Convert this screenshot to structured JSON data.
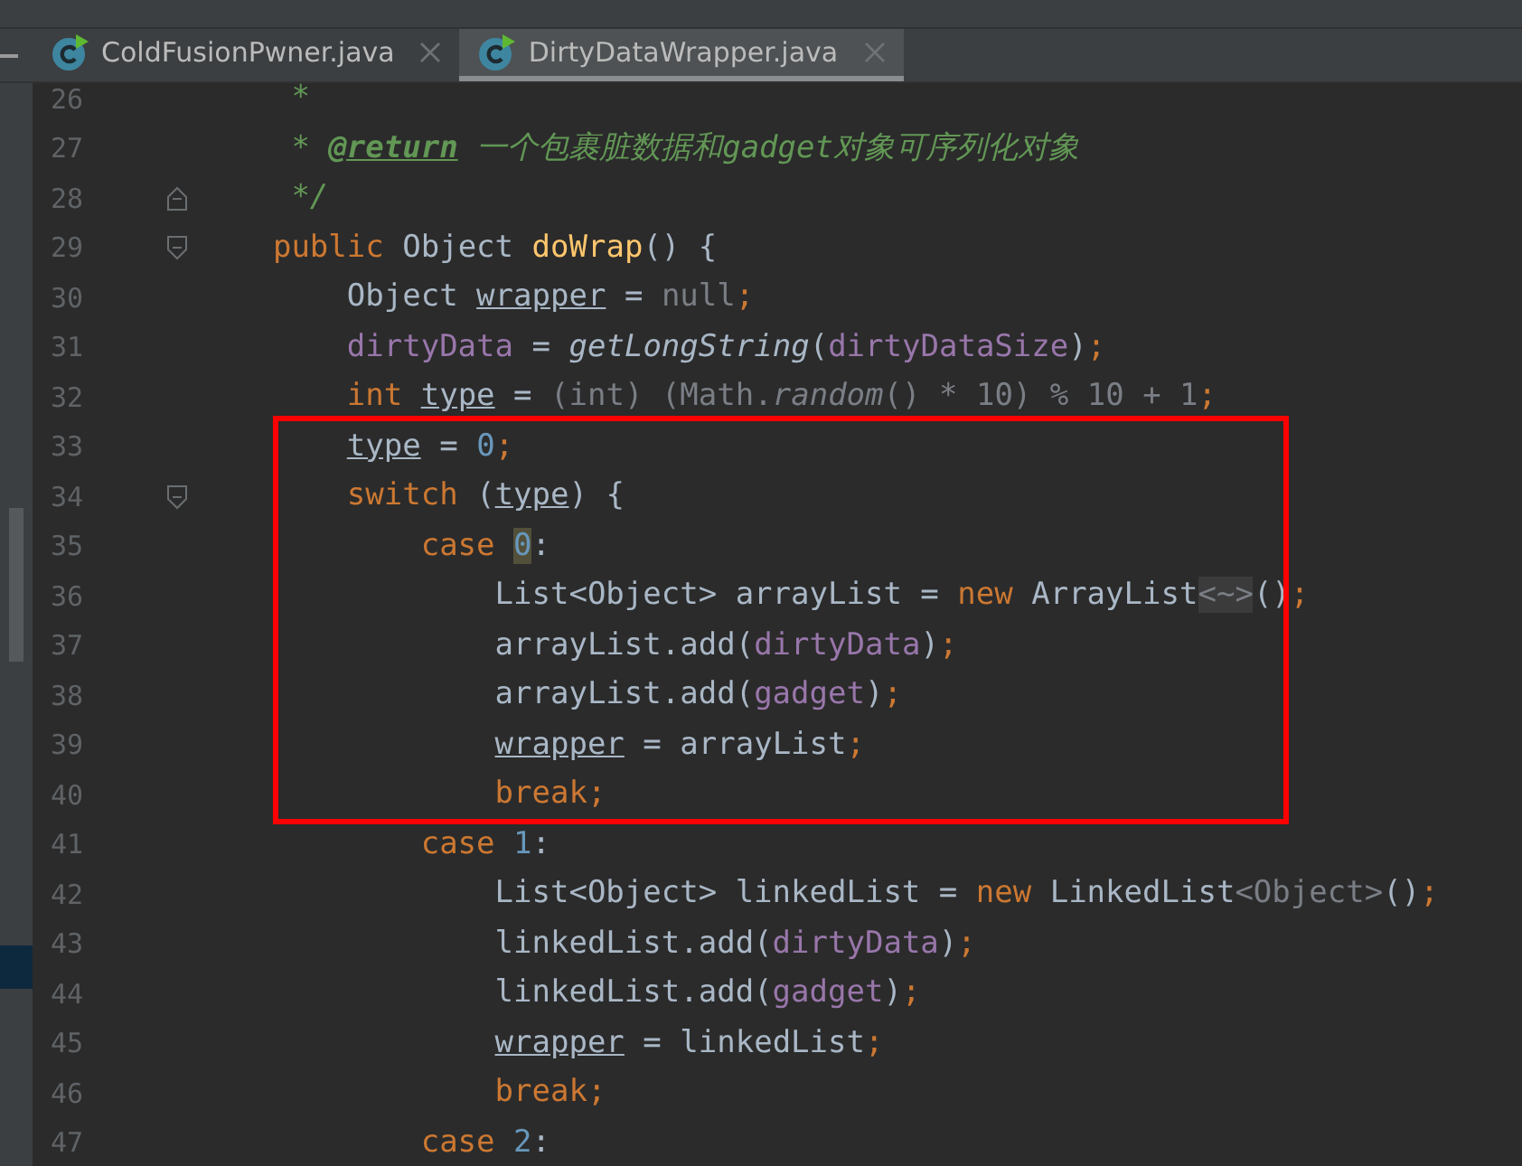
{
  "tabs": [
    {
      "label": "ColdFusionPwner.java",
      "selected": false
    },
    {
      "label": "DirtyDataWrapper.java",
      "selected": true
    }
  ],
  "lines": [
    {
      "number": "26",
      "boxed": false,
      "fold_start": false,
      "fold_end": false,
      "tokens": [
        {
          "t": "     *",
          "kind": "doc"
        }
      ]
    },
    {
      "number": "27",
      "boxed": false,
      "fold_start": false,
      "fold_end": false,
      "tokens": [
        {
          "t": "     * ",
          "kind": "doc"
        },
        {
          "t": "@return",
          "kind": "doctag"
        },
        {
          "t": " 一个包裹脏数据和gadget对象可序列化对象",
          "kind": "doc"
        }
      ]
    },
    {
      "number": "28",
      "boxed": false,
      "fold_start": false,
      "fold_end": true,
      "tokens": [
        {
          "t": "     */",
          "kind": "doc"
        }
      ]
    },
    {
      "number": "29",
      "boxed": false,
      "fold_start": true,
      "fold_end": false,
      "tokens": [
        {
          "t": "    public ",
          "kind": "kw"
        },
        {
          "t": "Object ",
          "kind": "plain"
        },
        {
          "t": "doWrap",
          "kind": "method"
        },
        {
          "t": "() {",
          "kind": "plain"
        }
      ]
    },
    {
      "number": "30",
      "boxed": false,
      "fold_start": false,
      "fold_end": false,
      "tokens": [
        {
          "t": "        Object ",
          "kind": "plain"
        },
        {
          "t": "wrapper",
          "kind": "var"
        },
        {
          "t": " = ",
          "kind": "plain"
        },
        {
          "t": "null",
          "kind": "dim"
        },
        {
          "t": ";",
          "kind": "kw"
        }
      ]
    },
    {
      "number": "31",
      "boxed": false,
      "fold_start": false,
      "fold_end": false,
      "tokens": [
        {
          "t": "        dirtyData",
          "kind": "field"
        },
        {
          "t": " = ",
          "kind": "plain"
        },
        {
          "t": "getLongString",
          "kind": "italic"
        },
        {
          "t": "(",
          "kind": "plain"
        },
        {
          "t": "dirtyDataSize",
          "kind": "field"
        },
        {
          "t": ")",
          "kind": "plain"
        },
        {
          "t": ";",
          "kind": "kw"
        }
      ]
    },
    {
      "number": "32",
      "boxed": false,
      "fold_start": false,
      "fold_end": false,
      "tokens": [
        {
          "t": "        int ",
          "kind": "kw"
        },
        {
          "t": "type",
          "kind": "var"
        },
        {
          "t": " = ",
          "kind": "plain"
        },
        {
          "t": "(int) (Math.",
          "kind": "dim"
        },
        {
          "t": "random",
          "kind": "dimitalic"
        },
        {
          "t": "() * 10) % 10 + 1",
          "kind": "dim"
        },
        {
          "t": ";",
          "kind": "kw"
        }
      ]
    },
    {
      "number": "33",
      "boxed": true,
      "fold_start": false,
      "fold_end": false,
      "tokens": [
        {
          "t": "        type",
          "kind": "var"
        },
        {
          "t": " = ",
          "kind": "plain"
        },
        {
          "t": "0",
          "kind": "num"
        },
        {
          "t": ";",
          "kind": "kw"
        }
      ]
    },
    {
      "number": "34",
      "boxed": true,
      "fold_start": true,
      "fold_end": false,
      "tokens": [
        {
          "t": "        switch ",
          "kind": "kw"
        },
        {
          "t": "(",
          "kind": "plain"
        },
        {
          "t": "type",
          "kind": "var"
        },
        {
          "t": ") {",
          "kind": "plain"
        }
      ]
    },
    {
      "number": "35",
      "boxed": true,
      "fold_start": false,
      "fold_end": false,
      "tokens": [
        {
          "t": "            case ",
          "kind": "kw"
        },
        {
          "t": "0",
          "kind": "caret"
        },
        {
          "t": ":",
          "kind": "plain"
        }
      ]
    },
    {
      "number": "36",
      "boxed": true,
      "fold_start": false,
      "fold_end": false,
      "tokens": [
        {
          "t": "                List<Object> arrayList = ",
          "kind": "plain"
        },
        {
          "t": "new ",
          "kind": "kw"
        },
        {
          "t": "ArrayList",
          "kind": "plain"
        },
        {
          "t": "<~>",
          "kind": "hint"
        },
        {
          "t": "()",
          "kind": "plain"
        },
        {
          "t": ";",
          "kind": "kw"
        }
      ]
    },
    {
      "number": "37",
      "boxed": true,
      "fold_start": false,
      "fold_end": false,
      "tokens": [
        {
          "t": "                arrayList.add(",
          "kind": "plain"
        },
        {
          "t": "dirtyData",
          "kind": "field"
        },
        {
          "t": ")",
          "kind": "plain"
        },
        {
          "t": ";",
          "kind": "kw"
        }
      ]
    },
    {
      "number": "38",
      "boxed": true,
      "fold_start": false,
      "fold_end": false,
      "tokens": [
        {
          "t": "                arrayList.add(",
          "kind": "plain"
        },
        {
          "t": "gadget",
          "kind": "field"
        },
        {
          "t": ")",
          "kind": "plain"
        },
        {
          "t": ";",
          "kind": "kw"
        }
      ]
    },
    {
      "number": "39",
      "boxed": true,
      "fold_start": false,
      "fold_end": false,
      "tokens": [
        {
          "t": "                wrapper",
          "kind": "var"
        },
        {
          "t": " = arrayList",
          "kind": "plain"
        },
        {
          "t": ";",
          "kind": "kw"
        }
      ]
    },
    {
      "number": "40",
      "boxed": true,
      "fold_start": false,
      "fold_end": false,
      "tokens": [
        {
          "t": "                break;",
          "kind": "kw"
        }
      ]
    },
    {
      "number": "41",
      "boxed": false,
      "fold_start": false,
      "fold_end": false,
      "tokens": [
        {
          "t": "            case ",
          "kind": "kw"
        },
        {
          "t": "1",
          "kind": "num"
        },
        {
          "t": ":",
          "kind": "plain"
        }
      ]
    },
    {
      "number": "42",
      "boxed": false,
      "fold_start": false,
      "fold_end": false,
      "tokens": [
        {
          "t": "                List<Object> linkedList = ",
          "kind": "plain"
        },
        {
          "t": "new ",
          "kind": "kw"
        },
        {
          "t": "LinkedList",
          "kind": "plain"
        },
        {
          "t": "<Object>",
          "kind": "dim"
        },
        {
          "t": "()",
          "kind": "plain"
        },
        {
          "t": ";",
          "kind": "kw"
        }
      ]
    },
    {
      "number": "43",
      "boxed": false,
      "fold_start": false,
      "fold_end": false,
      "tokens": [
        {
          "t": "                linkedList.add(",
          "kind": "plain"
        },
        {
          "t": "dirtyData",
          "kind": "field"
        },
        {
          "t": ")",
          "kind": "plain"
        },
        {
          "t": ";",
          "kind": "kw"
        }
      ]
    },
    {
      "number": "44",
      "boxed": false,
      "fold_start": false,
      "fold_end": false,
      "tokens": [
        {
          "t": "                linkedList.add(",
          "kind": "plain"
        },
        {
          "t": "gadget",
          "kind": "field"
        },
        {
          "t": ")",
          "kind": "plain"
        },
        {
          "t": ";",
          "kind": "kw"
        }
      ]
    },
    {
      "number": "45",
      "boxed": false,
      "fold_start": false,
      "fold_end": false,
      "tokens": [
        {
          "t": "                wrapper",
          "kind": "var"
        },
        {
          "t": " = linkedList",
          "kind": "plain"
        },
        {
          "t": ";",
          "kind": "kw"
        }
      ]
    },
    {
      "number": "46",
      "boxed": false,
      "fold_start": false,
      "fold_end": false,
      "tokens": [
        {
          "t": "                break;",
          "kind": "kw"
        }
      ]
    },
    {
      "number": "47",
      "boxed": false,
      "fold_start": false,
      "fold_end": false,
      "tokens": [
        {
          "t": "            case ",
          "kind": "kw"
        },
        {
          "t": "2",
          "kind": "num"
        },
        {
          "t": ":",
          "kind": "plain"
        }
      ]
    }
  ]
}
